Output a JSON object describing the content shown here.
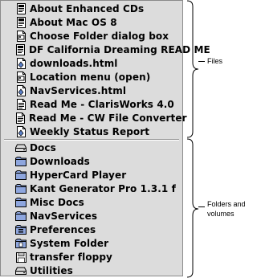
{
  "files": [
    {
      "label": "About Enhanced CDs",
      "icon": "app-document-icon"
    },
    {
      "label": "About Mac OS 8",
      "icon": "app-document-icon"
    },
    {
      "label": "Choose Folder dialog box",
      "icon": "picture-document-icon"
    },
    {
      "label": "DF California Dreaming READ ME",
      "icon": "app-document-icon"
    },
    {
      "label": "downloads.html",
      "icon": "html-document-icon"
    },
    {
      "label": "Location menu (open)",
      "icon": "picture-document-icon"
    },
    {
      "label": "NavServices.html",
      "icon": "html-document-icon"
    },
    {
      "label": "Read Me - ClarisWorks 4.0",
      "icon": "text-document-icon"
    },
    {
      "label": "Read Me - CW File Converter",
      "icon": "text-document-icon"
    },
    {
      "label": "Weekly Status Report",
      "icon": "html-document-icon"
    }
  ],
  "folders": [
    {
      "label": "Docs",
      "icon": "disk-icon"
    },
    {
      "label": "Downloads",
      "icon": "folder-icon"
    },
    {
      "label": "HyperCard Player",
      "icon": "folder-icon"
    },
    {
      "label": "Kant Generator Pro 1.3.1 f",
      "icon": "folder-icon"
    },
    {
      "label": "Misc Docs",
      "icon": "folder-icon"
    },
    {
      "label": "NavServices",
      "icon": "folder-icon"
    },
    {
      "label": "Preferences",
      "icon": "preferences-folder-icon"
    },
    {
      "label": "System Folder",
      "icon": "system-folder-icon"
    },
    {
      "label": "transfer floppy",
      "icon": "floppy-icon"
    },
    {
      "label": "Utilities",
      "icon": "disk-icon"
    }
  ],
  "annotations": {
    "files": "Files",
    "folders_line1": "Folders and",
    "folders_line2": "volumes"
  }
}
